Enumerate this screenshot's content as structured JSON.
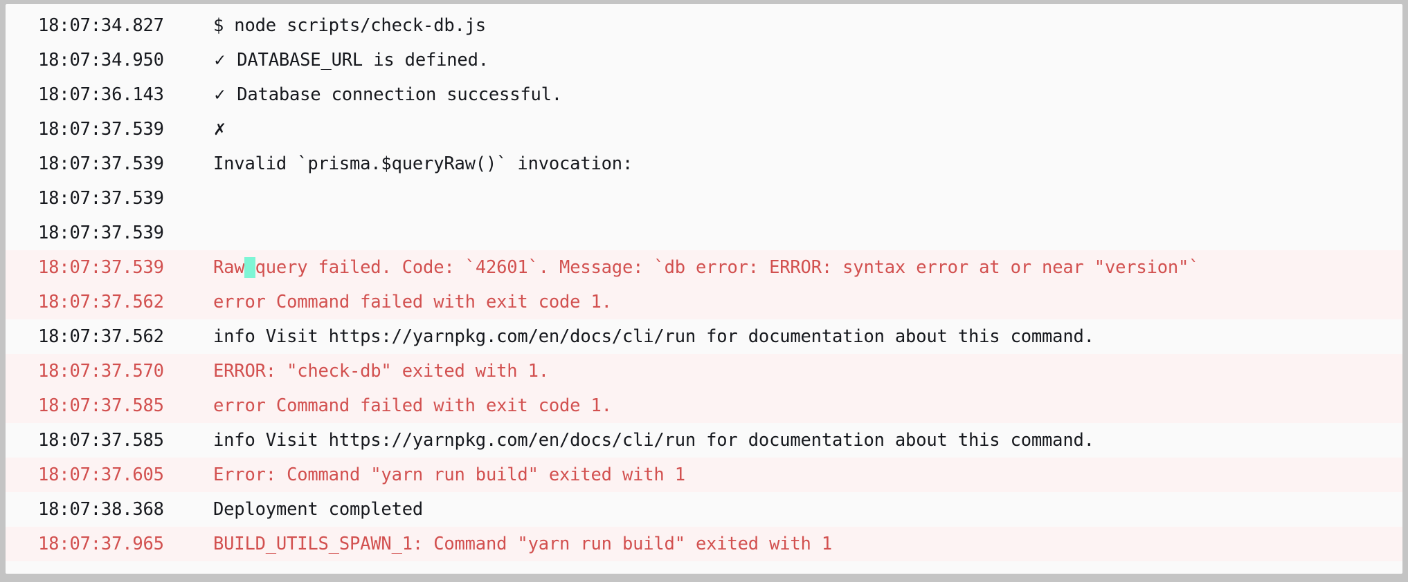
{
  "panel": {
    "name": "deployment-build-log",
    "background_color": "#fafafa",
    "frame_color": "#c4c4c4",
    "error_row_background": "#fdf3f3",
    "error_text_color": "#d2504f",
    "normal_text_color": "#16181d",
    "selection_highlight_color": "#7ff5d5"
  },
  "log": {
    "lines": [
      {
        "timestamp": "18:07:34.827",
        "level": "normal",
        "message": "$ node scripts/check-db.js",
        "icon": ""
      },
      {
        "timestamp": "18:07:34.950",
        "level": "normal",
        "message": "DATABASE_URL is defined.",
        "icon": "check-icon",
        "glyph": "✓"
      },
      {
        "timestamp": "18:07:36.143",
        "level": "normal",
        "message": "Database connection successful.",
        "icon": "check-icon",
        "glyph": "✓"
      },
      {
        "timestamp": "18:07:37.539",
        "level": "normal",
        "message": "",
        "icon": "cross-icon",
        "glyph": "✗"
      },
      {
        "timestamp": "18:07:37.539",
        "level": "normal",
        "message": "Invalid `prisma.$queryRaw()` invocation:",
        "icon": ""
      },
      {
        "timestamp": "18:07:37.539",
        "level": "normal",
        "message": "",
        "icon": ""
      },
      {
        "timestamp": "18:07:37.539",
        "level": "normal",
        "message": "",
        "icon": ""
      },
      {
        "timestamp": "18:07:37.539",
        "level": "error",
        "message_before_highlight": "Raw",
        "highlighted_text": " ",
        "message_after_highlight": "query failed. Code: `42601`. Message: `db error: ERROR: syntax error at or near \"version\"`",
        "message": "Raw query failed. Code: `42601`. Message: `db error: ERROR: syntax error at or near \"version\"`",
        "has_selection": true
      },
      {
        "timestamp": "18:07:37.562",
        "level": "error",
        "message": "error Command failed with exit code 1.",
        "icon": ""
      },
      {
        "timestamp": "18:07:37.562",
        "level": "normal",
        "message": "info Visit https://yarnpkg.com/en/docs/cli/run for documentation about this command.",
        "icon": ""
      },
      {
        "timestamp": "18:07:37.570",
        "level": "error",
        "message": "ERROR: \"check-db\" exited with 1.",
        "icon": ""
      },
      {
        "timestamp": "18:07:37.585",
        "level": "error",
        "message": "error Command failed with exit code 1.",
        "icon": ""
      },
      {
        "timestamp": "18:07:37.585",
        "level": "normal",
        "message": "info Visit https://yarnpkg.com/en/docs/cli/run for documentation about this command.",
        "icon": ""
      },
      {
        "timestamp": "18:07:37.605",
        "level": "error",
        "message": "Error: Command \"yarn run build\" exited with 1",
        "icon": ""
      },
      {
        "timestamp": "18:07:38.368",
        "level": "normal",
        "message": "Deployment completed",
        "icon": ""
      },
      {
        "timestamp": "18:07:37.965",
        "level": "error",
        "message": "BUILD_UTILS_SPAWN_1: Command \"yarn run build\" exited with 1",
        "icon": ""
      }
    ]
  }
}
